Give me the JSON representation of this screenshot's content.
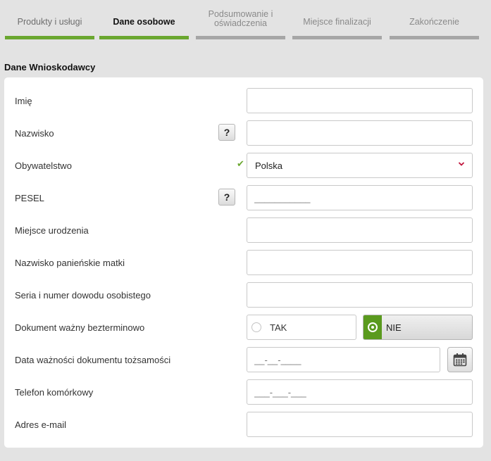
{
  "steps": [
    {
      "label": "Produkty i usługi",
      "state": "done"
    },
    {
      "label": "Dane osobowe",
      "state": "active"
    },
    {
      "label": "Podsumowanie i oświadczenia",
      "state": "todo"
    },
    {
      "label": "Miejsce finalizacji",
      "state": "todo"
    },
    {
      "label": "Zakończenie",
      "state": "todo"
    }
  ],
  "section_title": "Dane Wnioskodawcy",
  "help_symbol": "?",
  "valid_mark": "✔",
  "form": {
    "imie": {
      "label": "Imię",
      "value": ""
    },
    "nazwisko": {
      "label": "Nazwisko",
      "value": ""
    },
    "obywatelstwo": {
      "label": "Obywatelstwo",
      "value": "Polska"
    },
    "pesel": {
      "label": "PESEL",
      "placeholder": "___________"
    },
    "miejsce_urodzenia": {
      "label": "Miejsce urodzenia",
      "value": ""
    },
    "nazwisko_matki": {
      "label": "Nazwisko panieńskie matki",
      "value": ""
    },
    "dowod": {
      "label": "Seria i numer dowodu osobistego",
      "value": ""
    },
    "dokument_wazny": {
      "label": "Dokument ważny bezterminowo",
      "option_yes": "TAK",
      "option_no": "NIE",
      "selected": "NIE"
    },
    "data_waznosci": {
      "label": "Data ważności dokumentu tożsamości",
      "placeholder": "__-__-____"
    },
    "telefon": {
      "label": "Telefon komórkowy",
      "placeholder": "___-___-___"
    },
    "email": {
      "label": "Adres e-mail",
      "value": ""
    }
  },
  "colors": {
    "accent": "#6aa72f",
    "selected_radio": "#5a9a1e",
    "chevron": "#c0143c",
    "background": "#e3e3e3"
  },
  "icons": {
    "help": "question-icon",
    "valid": "check-icon",
    "select": "chevron-down-icon",
    "calendar": "calendar-icon"
  }
}
